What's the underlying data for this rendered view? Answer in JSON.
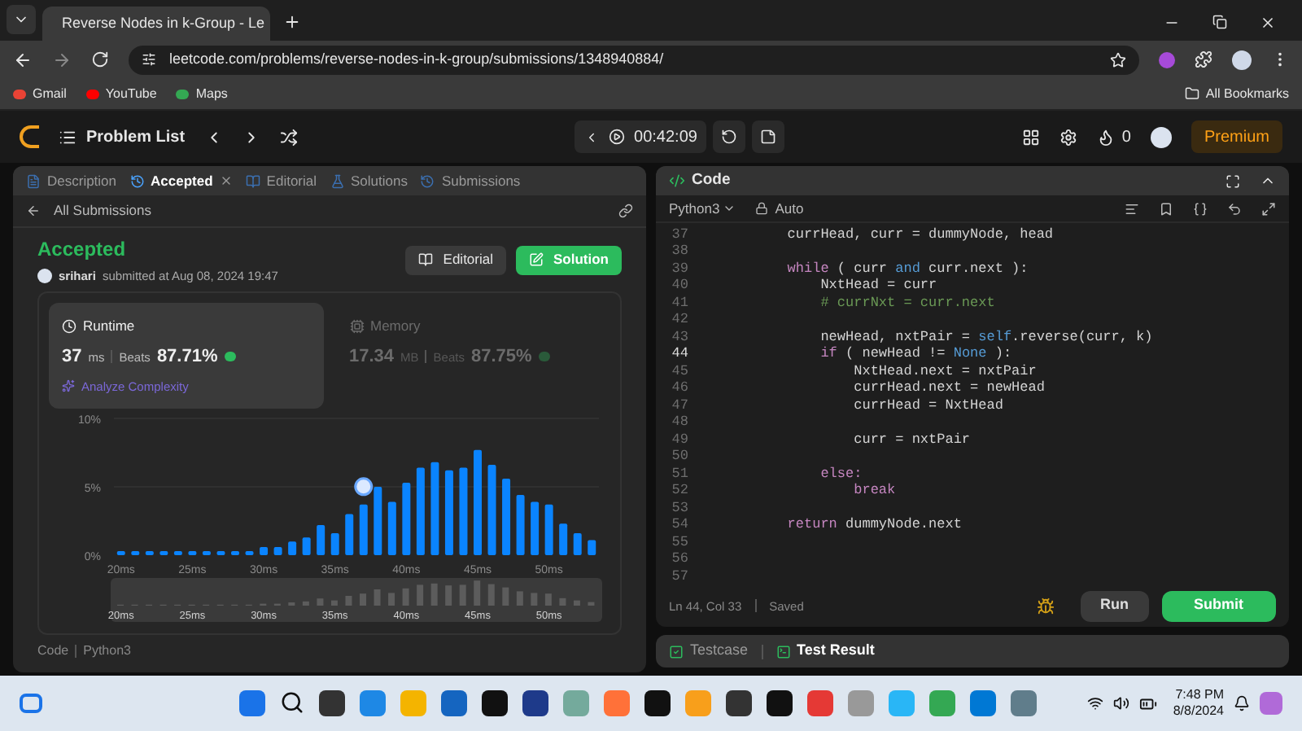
{
  "browser": {
    "tab_title": "Reverse Nodes in k-Group - Le",
    "url": "leetcode.com/problems/reverse-nodes-in-k-group/submissions/1348940884/",
    "bookmarks": [
      "Gmail",
      "YouTube",
      "Maps"
    ],
    "all_bookmarks": "All Bookmarks"
  },
  "navbar": {
    "problem_list": "Problem List",
    "timer": "00:42:09",
    "streak": "0",
    "premium": "Premium"
  },
  "left_panel": {
    "tabs": [
      {
        "label": "Description",
        "selected": false,
        "closable": false
      },
      {
        "label": "Accepted",
        "selected": true,
        "closable": true
      },
      {
        "label": "Editorial",
        "selected": false,
        "closable": false
      },
      {
        "label": "Solutions",
        "selected": false,
        "closable": false
      },
      {
        "label": "Submissions",
        "selected": false,
        "closable": false
      }
    ],
    "back_link": "All Submissions",
    "submission": {
      "status": "Accepted",
      "user": "srihari",
      "submitted": "submitted at Aug 08, 2024 19:47",
      "editorial_button": "Editorial",
      "solution_button": "Solution"
    },
    "stats": [
      {
        "kind": "runtime",
        "label": "Runtime",
        "value": "37",
        "unit": "ms",
        "beats_label": "Beats",
        "beats": "87.71%",
        "selected": true,
        "link": "Analyze Complexity"
      },
      {
        "kind": "memory",
        "label": "Memory",
        "value": "17.34",
        "unit": "MB",
        "beats_label": "Beats",
        "beats": "87.75%",
        "selected": false
      }
    ],
    "chart_data": {
      "type": "bar",
      "x": [
        20,
        21,
        22,
        23,
        24,
        25,
        26,
        27,
        28,
        29,
        30,
        31,
        32,
        33,
        34,
        35,
        36,
        37,
        38,
        39,
        40,
        41,
        42,
        43,
        44,
        45,
        46,
        47,
        48,
        49,
        50,
        51,
        52,
        53
      ],
      "xlim": [
        19.5,
        53.5
      ],
      "series": [
        {
          "color": "#0a84ff",
          "values": [
            0.3,
            0.3,
            0.3,
            0.3,
            0.3,
            0.3,
            0.3,
            0.3,
            0.3,
            0.3,
            0.6,
            0.6,
            1.0,
            1.3,
            2.2,
            1.6,
            3.0,
            3.7,
            5.0,
            3.9,
            5.3,
            6.4,
            6.8,
            6.2,
            6.4,
            7.7,
            6.6,
            5.6,
            4.4,
            3.9,
            3.7,
            2.3,
            1.6,
            1.1
          ]
        }
      ],
      "ylim": [
        0,
        10
      ],
      "xticks": [
        {
          "value": 20,
          "label": "20ms"
        },
        {
          "value": 25,
          "label": "25ms"
        },
        {
          "value": 30,
          "label": "30ms"
        },
        {
          "value": 35,
          "label": "35ms"
        },
        {
          "value": 40,
          "label": "40ms"
        },
        {
          "value": 45,
          "label": "45ms"
        },
        {
          "value": 50,
          "label": "50ms"
        }
      ],
      "yticks": [
        {
          "value": 0,
          "label": "0%"
        },
        {
          "value": 5,
          "label": "5%"
        },
        {
          "value": 10,
          "label": "10%"
        }
      ]
    },
    "overview_labels": [
      "20ms",
      "25ms",
      "30ms",
      "35ms",
      "40ms",
      "45ms",
      "50ms"
    ],
    "footer_tabs": [
      "Code",
      "Python3"
    ]
  },
  "code_panel": {
    "title": "Code",
    "language": "Python3",
    "mode": "Auto",
    "lines": [
      {
        "number": "37",
        "selected": false,
        "tokens": [
          {
            "text": "        currHead, curr = dummyNode, head",
            "kind": "plain"
          }
        ]
      },
      {
        "number": "38",
        "selected": false
      },
      {
        "number": "39",
        "selected": false,
        "tokens": [
          {
            "text": "        while",
            "kind": "keyword"
          },
          {
            "text": " ( curr ",
            "kind": "plain"
          },
          {
            "text": "and",
            "kind": "builtin"
          },
          {
            "text": " curr.next ):",
            "kind": "plain"
          }
        ]
      },
      {
        "number": "40",
        "selected": false,
        "tokens": [
          {
            "text": "            NxtHead = curr",
            "kind": "plain"
          }
        ]
      },
      {
        "number": "41",
        "selected": false,
        "tokens": [
          {
            "text": "            # currNxt = curr.next",
            "kind": "comment"
          }
        ]
      },
      {
        "number": "42",
        "selected": false
      },
      {
        "number": "43",
        "selected": false,
        "tokens": [
          {
            "text": "            newHead, nxtPair = ",
            "kind": "plain"
          },
          {
            "text": "self",
            "kind": "builtin"
          },
          {
            "text": ".reverse(curr, k)",
            "kind": "plain"
          }
        ]
      },
      {
        "number": "44",
        "selected": true,
        "tokens": [
          {
            "text": "            if",
            "kind": "keyword"
          },
          {
            "text": " ( newHead != ",
            "kind": "plain"
          },
          {
            "text": "None",
            "kind": "builtin"
          },
          {
            "text": " ):",
            "kind": "plain"
          }
        ]
      },
      {
        "number": "45",
        "selected": false,
        "tokens": [
          {
            "text": "                NxtHead.next = nxtPair",
            "kind": "plain"
          }
        ]
      },
      {
        "number": "46",
        "selected": false,
        "tokens": [
          {
            "text": "                currHead.next = newHead",
            "kind": "plain"
          }
        ]
      },
      {
        "number": "47",
        "selected": false,
        "tokens": [
          {
            "text": "                currHead = NxtHead",
            "kind": "plain"
          }
        ]
      },
      {
        "number": "48",
        "selected": false
      },
      {
        "number": "49",
        "selected": false,
        "tokens": [
          {
            "text": "                curr = nxtPair",
            "kind": "plain"
          }
        ]
      },
      {
        "number": "50",
        "selected": false
      },
      {
        "number": "51",
        "selected": false,
        "tokens": [
          {
            "text": "            else:",
            "kind": "keyword"
          }
        ]
      },
      {
        "number": "52",
        "selected": false,
        "tokens": [
          {
            "text": "                break",
            "kind": "keyword"
          }
        ]
      },
      {
        "number": "53",
        "selected": false
      },
      {
        "number": "54",
        "selected": false,
        "tokens": [
          {
            "text": "        return",
            "kind": "keyword"
          },
          {
            "text": " dummyNode.next",
            "kind": "plain"
          }
        ]
      },
      {
        "number": "55",
        "selected": false
      },
      {
        "number": "56",
        "selected": false
      },
      {
        "number": "57",
        "selected": false
      }
    ],
    "cursor": "Ln 44, Col 33",
    "save_state": "Saved",
    "run": "Run",
    "submit": "Submit"
  },
  "console": {
    "tabs": [
      {
        "label": "Testcase",
        "selected": false
      },
      {
        "label": "Test Result",
        "selected": true
      }
    ]
  },
  "taskbar": {
    "time": "7:48 PM",
    "date": "8/8/2024"
  }
}
